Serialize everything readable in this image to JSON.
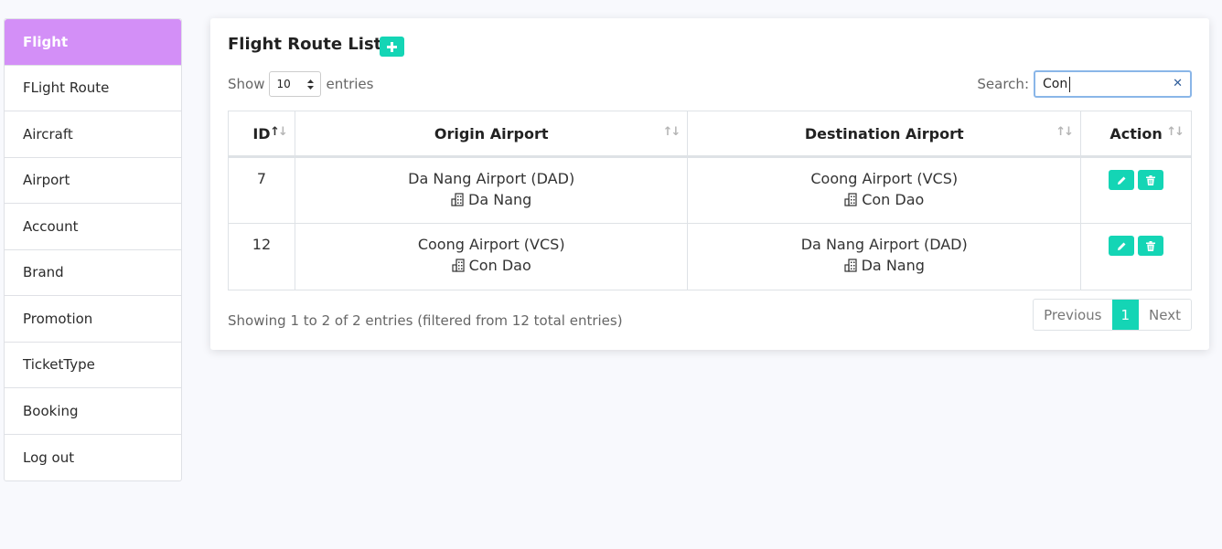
{
  "sidebar": {
    "items": [
      {
        "label": "Flight",
        "active": true
      },
      {
        "label": "FLight Route"
      },
      {
        "label": "Aircraft"
      },
      {
        "label": "Airport"
      },
      {
        "label": "Account"
      },
      {
        "label": "Brand"
      },
      {
        "label": "Promotion"
      },
      {
        "label": "TicketType"
      },
      {
        "label": "Booking"
      },
      {
        "label": "Log out"
      }
    ]
  },
  "card": {
    "title": "Flight Route List",
    "add_icon": "plus-icon"
  },
  "length": {
    "show_label": "Show",
    "value": "10",
    "entries_label": "entries"
  },
  "search": {
    "label": "Search:",
    "value": "Con"
  },
  "table": {
    "columns": [
      "ID",
      "Origin Airport",
      "Destination Airport",
      "Action"
    ],
    "rows": [
      {
        "id": "7",
        "origin_airport": "Da Nang Airport (DAD)",
        "origin_city": "Da Nang",
        "dest_airport": "Coong Airport (VCS)",
        "dest_city": "Con Dao"
      },
      {
        "id": "12",
        "origin_airport": "Coong Airport (VCS)",
        "origin_city": "Con Dao",
        "dest_airport": "Da Nang Airport (DAD)",
        "dest_city": "Da Nang"
      }
    ]
  },
  "info": "Showing 1 to 2 of 2 entries (filtered from 12 total entries)",
  "pagination": {
    "previous": "Previous",
    "current": "1",
    "next": "Next"
  },
  "colors": {
    "accent": "#14d5b5",
    "sidebar_active": "#d38ff7",
    "background": "#f8f9fd"
  }
}
